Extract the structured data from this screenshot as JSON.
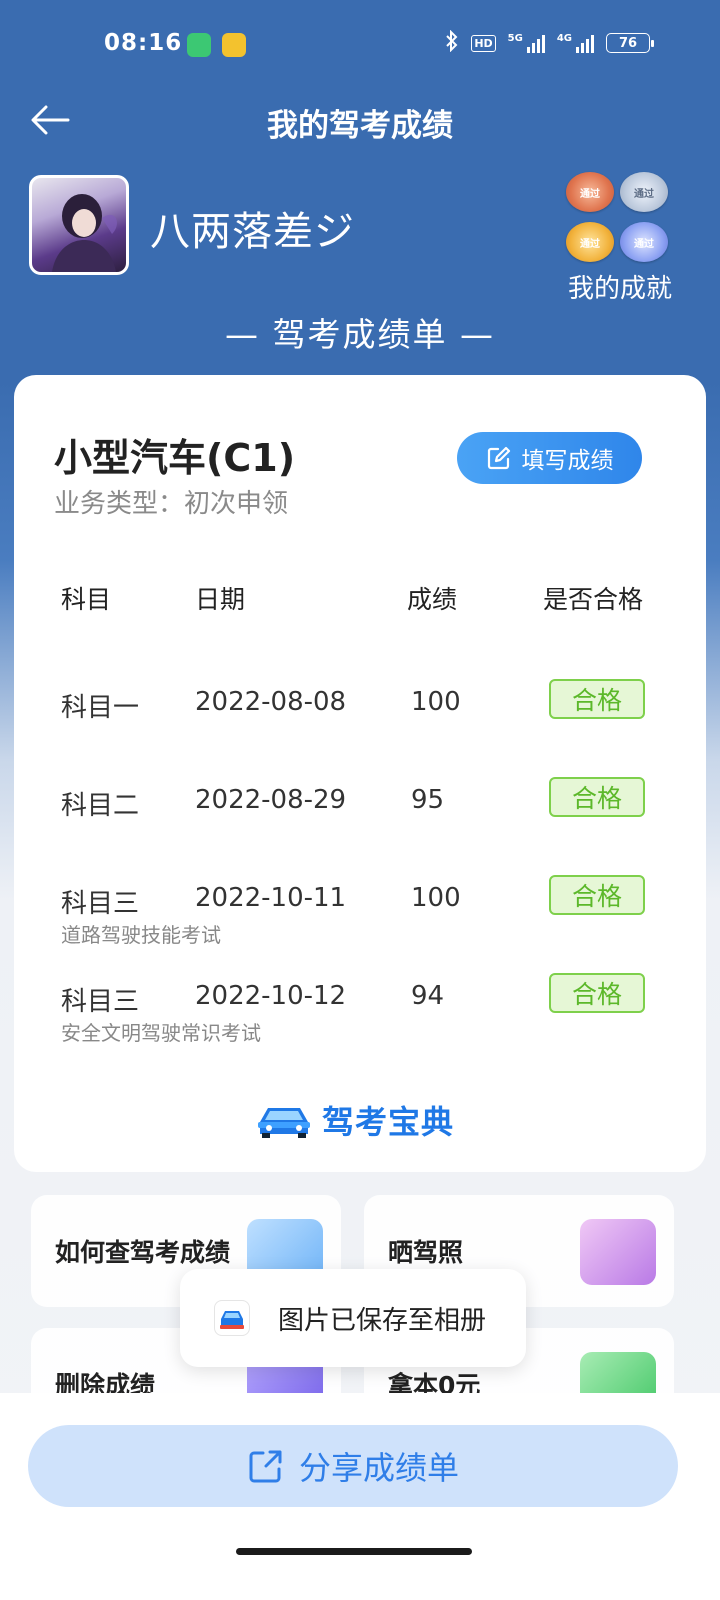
{
  "status_bar": {
    "time": "08:16",
    "network_1": "5G",
    "network_2": "4G",
    "hd": "HD",
    "battery": "76"
  },
  "header": {
    "title": "我的驾考成绩"
  },
  "profile": {
    "username": "八两落差ジ",
    "achievements_label": "我的成就",
    "medal_text": "通过"
  },
  "report": {
    "title": "— 驾考成绩单 —"
  },
  "card": {
    "vehicle_type": "小型汽车(C1)",
    "business_type": "业务类型：初次申领",
    "fill_button": "填写成绩",
    "columns": [
      "科目",
      "日期",
      "成绩",
      "是否合格"
    ],
    "rows": [
      {
        "subject": "科目一",
        "date": "2022-08-08",
        "score": "100",
        "status": "合格",
        "sub": ""
      },
      {
        "subject": "科目二",
        "date": "2022-08-29",
        "score": "95",
        "status": "合格",
        "sub": ""
      },
      {
        "subject": "科目三",
        "date": "2022-10-11",
        "score": "100",
        "status": "合格",
        "sub": "道路驾驶技能考试"
      },
      {
        "subject": "科目三",
        "date": "2022-10-12",
        "score": "94",
        "status": "合格",
        "sub": "安全文明驾驶常识考试"
      }
    ],
    "brand": "驾考宝典"
  },
  "tiles": [
    {
      "label": "如何查驾考成绩"
    },
    {
      "label": "晒驾照"
    },
    {
      "label": "删除成绩"
    },
    {
      "label": "拿本0元"
    }
  ],
  "toast": {
    "text": "图片已保存至相册"
  },
  "bottom": {
    "share_label": "分享成绩单"
  },
  "colors": {
    "header_blue": "#3a6cb0",
    "accent_blue": "#2f86ea",
    "pass_green": "#5cb82a"
  }
}
